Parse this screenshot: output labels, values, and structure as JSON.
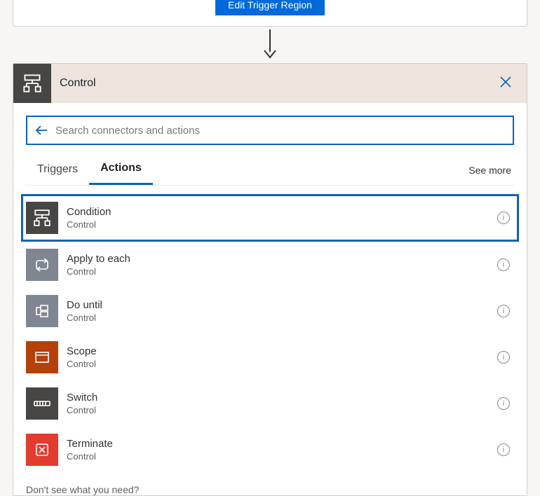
{
  "top_button": "Edit Trigger Region",
  "panel_title": "Control",
  "search_placeholder": "Search connectors and actions",
  "tabs": {
    "triggers": "Triggers",
    "actions": "Actions"
  },
  "see_more": "See more",
  "actions": [
    {
      "title": "Condition",
      "subtitle": "Control",
      "icon": "condition",
      "color": "darkgrey",
      "highlight": true
    },
    {
      "title": "Apply to each",
      "subtitle": "Control",
      "icon": "loop",
      "color": "grey",
      "highlight": false
    },
    {
      "title": "Do until",
      "subtitle": "Control",
      "icon": "dountil",
      "color": "grey",
      "highlight": false
    },
    {
      "title": "Scope",
      "subtitle": "Control",
      "icon": "scope",
      "color": "orange",
      "highlight": false
    },
    {
      "title": "Switch",
      "subtitle": "Control",
      "icon": "switch",
      "color": "darkgrey",
      "highlight": false
    },
    {
      "title": "Terminate",
      "subtitle": "Control",
      "icon": "terminate",
      "color": "red",
      "highlight": false
    }
  ],
  "footer": "Don't see what you need?"
}
